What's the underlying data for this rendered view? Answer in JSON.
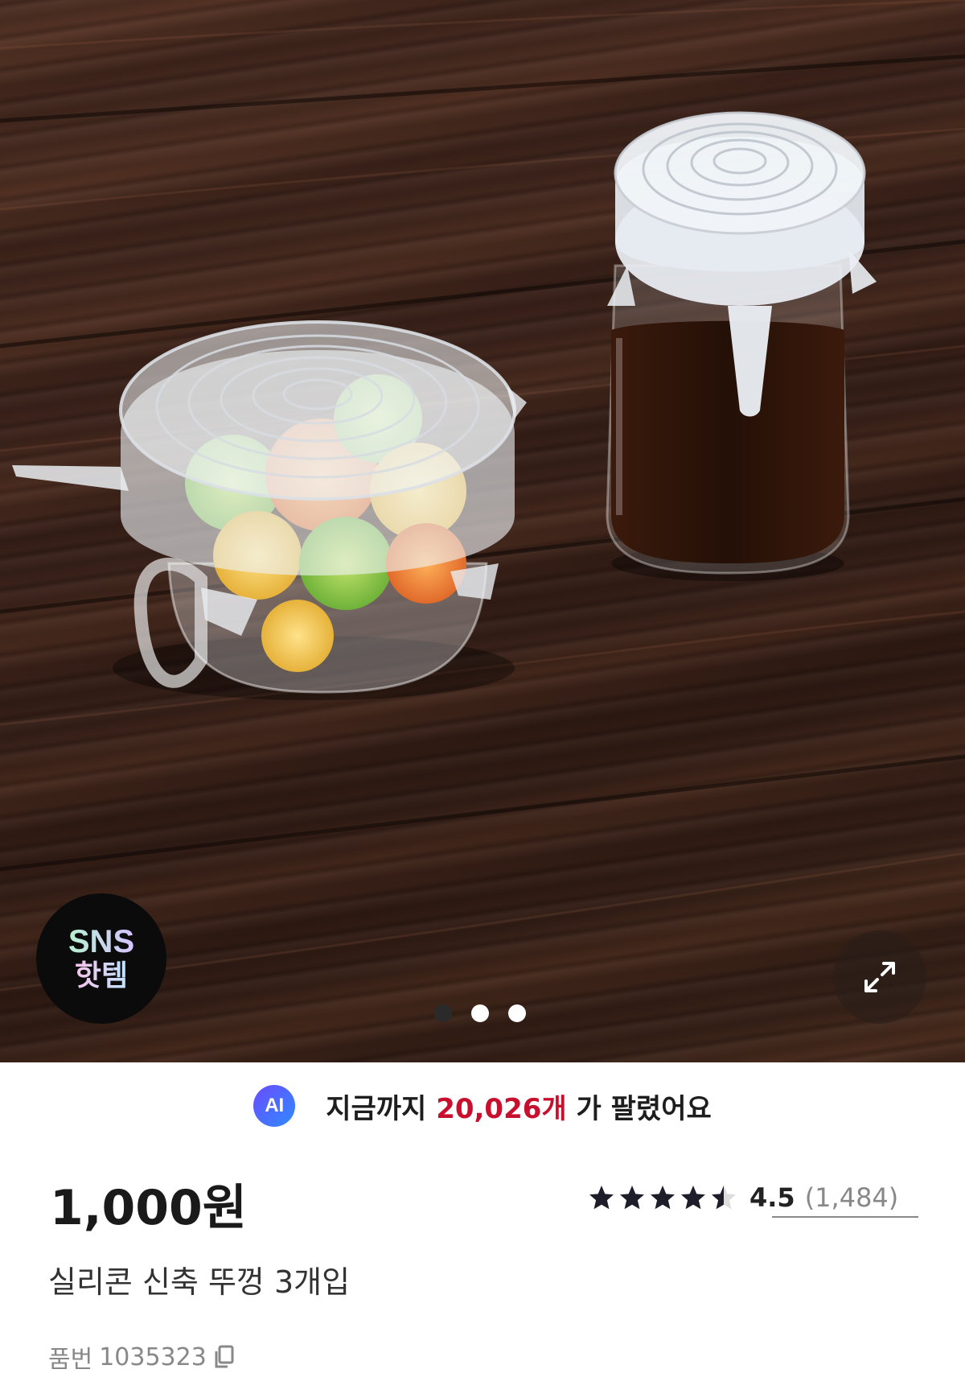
{
  "hero": {
    "badge_line1": "SNS",
    "badge_line2": "핫템",
    "carousel_total": 3,
    "carousel_active": 1,
    "expand_icon": "expand-arrows-icon"
  },
  "sold_banner": {
    "ai_label": "AI",
    "prefix": "지금까지",
    "count": "20,026개",
    "suffix": "가 팔렸어요",
    "accent_color": "#c8102e"
  },
  "product": {
    "price": "1,000원",
    "rating_score": "4.5",
    "rating_count": "(1,484)",
    "rating_value": 4.5,
    "rating_max": 5,
    "name": "실리콘 신축 뚜껑 3개입",
    "code_label": "품번",
    "code_value": "1035323",
    "copy_icon": "copy-icon"
  }
}
